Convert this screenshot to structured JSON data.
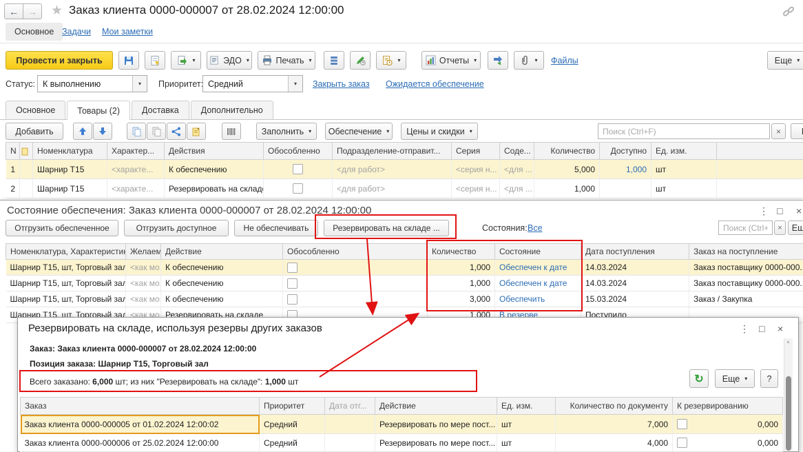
{
  "glyphs": {
    "back": "←",
    "forward": "→",
    "star": "★",
    "menu": "⋮",
    "maximize": "□",
    "close": "×",
    "clear": "×",
    "caret": "▾",
    "refresh": "↻",
    "help": "?",
    "scroll_up": "▲"
  },
  "colors": {
    "accent_yellow": "#f7ca16",
    "selection_row": "#fcf4cf",
    "selection_cell": "#f7e193",
    "link_blue": "#2b6cb5",
    "annotation_red": "#e11212"
  },
  "top_bar": {
    "title": "Заказ клиента 0000-000007 от 28.02.2024 12:00:00"
  },
  "nav_tabs": {
    "main": "Основное",
    "tasks": "Задачи",
    "notes": "Мои заметки"
  },
  "toolbar": {
    "post_close": "Провести и закрыть",
    "edo": "ЭДО",
    "print": "Печать",
    "reports": "Отчеты",
    "files": "Файлы",
    "more": "Еще"
  },
  "status_row": {
    "status_label": "Статус:",
    "status_value": "К выполнению",
    "priority_label": "Приоритет:",
    "priority_value": "Средний",
    "close_order": "Закрыть заказ",
    "awaiting": "Ожидается обеспечение"
  },
  "section_tabs": {
    "main": "Основное",
    "goods": "Товары (2)",
    "delivery": "Доставка",
    "extra": "Дополнительно"
  },
  "items_toolbar": {
    "add": "Добавить",
    "fill": "Заполнить",
    "supply": "Обеспечение",
    "prices": "Цены и скидки",
    "search_placeholder": "Поиск (Ctrl+F)",
    "more_cut": "Е"
  },
  "items_table": {
    "headers": {
      "n": "N",
      "nomenclature": "Номенклатура",
      "characteristic": "Характер...",
      "actions": "Действия",
      "separate": "Обособленно",
      "department": "Подразделение-отправит...",
      "series": "Серия",
      "content": "Соде...",
      "quantity": "Количество",
      "available": "Доступно",
      "unit": "Ед. изм."
    },
    "rows": [
      {
        "n": "1",
        "nomenclature": "Шарнир Т15",
        "characteristic": "<характе...",
        "action": "К обеспечению",
        "department": "<для работ>",
        "series": "<серия н...",
        "content": "<для ...",
        "quantity": "5,000",
        "available": "1,000",
        "unit": "шт"
      },
      {
        "n": "2",
        "nomenclature": "Шарнир Т15",
        "characteristic": "<характе...",
        "action": "Резервировать на складе",
        "department": "<для работ>",
        "series": "<серия н...",
        "content": "<для ...",
        "quantity": "1,000",
        "available": "",
        "unit": "шт"
      }
    ]
  },
  "supply_window": {
    "title": "Состояние обеспечения: Заказ клиента 0000-000007 от 28.02.2024 12:00:00",
    "buttons": {
      "ship_supplied": "Отгрузить обеспеченное",
      "ship_available": "Отгрузить доступное",
      "no_supply": "Не обеспечивать",
      "reserve": "Резервировать на складе ...",
      "states_label": "Состояния:",
      "states_value": "Все",
      "more": "Еще"
    },
    "search_placeholder": "Поиск (Ctrl+F)",
    "table": {
      "headers": {
        "item": "Номенклатура, Характеристика, Ед. из...",
        "desired": "Желаем...",
        "action": "Действие",
        "separate": "Обособленно",
        "quantity": "Количество",
        "state": "Состояние",
        "receipt_date": "Дата поступления",
        "receipt_order": "Заказ на поступление"
      },
      "rows": [
        {
          "item": "Шарнир Т15, шт, Торговый зал",
          "desired": "<как мо...",
          "action": "К обеспечению",
          "quantity": "1,000",
          "state": "Обеспечен к дате",
          "receipt_date": "14.03.2024",
          "receipt_order": "Заказ поставщику 0000-000..."
        },
        {
          "item": "Шарнир Т15, шт, Торговый зал",
          "desired": "<как мо...",
          "action": "К обеспечению",
          "quantity": "1,000",
          "state": "Обеспечен к дате",
          "receipt_date": "14.03.2024",
          "receipt_order": "Заказ поставщику 0000-000..."
        },
        {
          "item": "Шарнир Т15, шт, Торговый зал",
          "desired": "<как мо...",
          "action": "К обеспечению",
          "quantity": "3,000",
          "state": "Обеспечить",
          "receipt_date": "15.03.2024",
          "receipt_order": "Заказ / Закупка"
        },
        {
          "item": "Шарнир Т15, шт, Торговый зал",
          "desired": "<как мо...",
          "action": "Резервировать на складе",
          "quantity": "1,000",
          "state": "В резерве",
          "receipt_date": "Поступило",
          "receipt_order": ""
        }
      ]
    }
  },
  "reserve_window": {
    "title": "Резервировать на складе, используя резервы других заказов",
    "order_line": "Заказ: Заказ клиента 0000-000007 от 28.02.2024 12:00:00",
    "position_line": "Позиция заказа: Шарнир Т15, Торговый зал",
    "total_line": {
      "prefix": "Всего заказано: ",
      "total": "6,000",
      "mid": " шт; из них \"Резервировать на складе\": ",
      "reserve": "1,000",
      "suffix": " шт"
    },
    "more": "Еще",
    "table": {
      "headers": {
        "order": "Заказ",
        "priority": "Приоритет",
        "ship_date": "Дата отг...",
        "action": "Действие",
        "unit": "Ед. изм.",
        "doc_qty": "Количество по документу",
        "to_reserve": "К резервированию"
      },
      "rows": [
        {
          "order": "Заказ клиента 0000-000005 от 01.02.2024 12:00:02",
          "priority": "Средний",
          "ship_date": "",
          "action": "Резервировать по мере пост...",
          "unit": "шт",
          "doc_qty": "7,000",
          "to_reserve": "0,000"
        },
        {
          "order": "Заказ клиента 0000-000006 от 25.02.2024 12:00:00",
          "priority": "Средний",
          "ship_date": "",
          "action": "Резервировать по мере пост...",
          "unit": "шт",
          "doc_qty": "4,000",
          "to_reserve": "0,000"
        }
      ]
    }
  }
}
